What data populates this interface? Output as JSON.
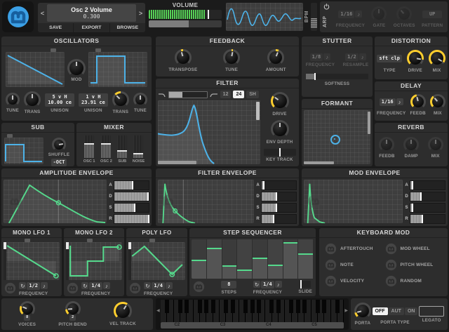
{
  "colors": {
    "blue": "#4db2e8",
    "green": "#55d98c",
    "yellow": "#ffce2e",
    "panel": "#2d2d2d",
    "background": "#1b1b1b"
  },
  "header": {
    "patch_name": "Osc 2 Volume",
    "patch_value": "0.300",
    "prev": "<",
    "next": ">",
    "save": "SAVE",
    "export": "EXPORT",
    "browse": "BROWSE",
    "volume_label": "VOLUME",
    "bpm_label": "BPM",
    "arp": {
      "title": "ARP",
      "frequency_label": "FREQUENCY",
      "frequency_value": "1/16",
      "gate_label": "GATE",
      "gate_knob": {
        "value": 0.5,
        "mode": "plain",
        "dim": true
      },
      "octaves_label": "OCTAVES",
      "octaves_knob": {
        "value": 0.35,
        "mode": "plain",
        "dim": true
      },
      "pattern_label": "PATTERN",
      "pattern_value": "UP"
    }
  },
  "oscillators": {
    "title": "OSCILLATORS",
    "mod_label": "MOD",
    "mod_knob": {
      "value": 0.5,
      "mode": "plain"
    },
    "tune1_label": "TUNE",
    "tune1_knob": {
      "value": 0.5,
      "mode": "plain"
    },
    "trans1_label": "TRANS",
    "trans1_knob": {
      "value": 0.5,
      "mode": "plain"
    },
    "unison1_top": "5 v H",
    "unison1_bottom": "10.00 ce",
    "unison1_label": "UNISON",
    "unison2_top": "1 v H",
    "unison2_bottom": "23.91 ce",
    "unison2_label": "UNISON",
    "trans2_label": "TRANS",
    "trans2_knob": {
      "value": 0.33,
      "mode": "bi"
    },
    "tune2_label": "TUNE",
    "tune2_knob": {
      "value": 0.5,
      "mode": "plain"
    }
  },
  "sub": {
    "title": "SUB",
    "shuffle_label": "SHUFFLE",
    "shuffle_knob": {
      "value": 0.8,
      "mode": "plain"
    },
    "oct_button": "-OCT"
  },
  "mixer": {
    "title": "MIXER",
    "channels": [
      {
        "label": "OSC 1",
        "value": 0.6
      },
      {
        "label": "OSC 2",
        "value": 0.6
      },
      {
        "label": "SUB",
        "value": 0.28
      },
      {
        "label": "NOISE",
        "value": 0.17
      }
    ]
  },
  "feedback": {
    "title": "FEEDBACK",
    "knobs": [
      {
        "label": "TRANSPOSE",
        "value": 0.44,
        "mode": "bi"
      },
      {
        "label": "TUNE",
        "value": 0.54,
        "mode": "bi"
      },
      {
        "label": "AMOUNT",
        "value": 0.58,
        "mode": "bi"
      }
    ]
  },
  "filter": {
    "title": "FILTER",
    "pole_12": "12",
    "pole_24": "24",
    "pole_sh": "SH",
    "drive_label": "DRIVE",
    "drive_knob": {
      "value": 0.3,
      "mode": "uni"
    },
    "env_depth_label": "ENV DEPTH",
    "env_depth_knob": {
      "value": 0.5,
      "mode": "plain"
    },
    "key_track_label": "KEY TRACK"
  },
  "stutter": {
    "title": "STUTTER",
    "frequency_label": "FREQUENCY",
    "frequency_value": "1/8",
    "resample_label": "RESAMPLE",
    "resample_value": "1/2",
    "softness_label": "SOFTNESS"
  },
  "formant": {
    "title": "FORMANT"
  },
  "distortion": {
    "title": "DISTORTION",
    "type_label": "TYPE",
    "type_value": "sft clp",
    "drive_label": "DRIVE",
    "drive_knob": {
      "value": 0.87,
      "mode": "uni"
    },
    "mix_label": "MIX",
    "mix_knob": {
      "value": 0.95,
      "mode": "uni"
    }
  },
  "delay": {
    "title": "DELAY",
    "frequency_label": "FREQUENCY",
    "frequency_value": "1/16",
    "feedb_label": "FEEDB",
    "feedb_knob": {
      "value": 0.45,
      "mode": "uni"
    },
    "mix_label": "MIX",
    "mix_knob": {
      "value": 0.35,
      "mode": "uni"
    }
  },
  "reverb": {
    "title": "REVERB",
    "knobs": [
      {
        "label": "FEEDB",
        "value": 0.5,
        "mode": "plain",
        "dim": true
      },
      {
        "label": "DAMP",
        "value": 0.5,
        "mode": "plain",
        "dim": true
      },
      {
        "label": "MIX",
        "value": 0.5,
        "mode": "plain",
        "dim": true
      }
    ]
  },
  "envelopes": [
    {
      "title": "AMPLITUDE ENVELOPE",
      "adsr": [
        {
          "label": "A",
          "value": 0.52
        },
        {
          "label": "D",
          "value": 0.95
        },
        {
          "label": "S",
          "value": 0.58
        },
        {
          "label": "R",
          "value": 0.97
        }
      ]
    },
    {
      "title": "FILTER ENVELOPE",
      "adsr": [
        {
          "label": "A",
          "value": 0.05
        },
        {
          "label": "D",
          "value": 0.4
        },
        {
          "label": "S",
          "value": 0.4
        },
        {
          "label": "R",
          "value": 0.33
        }
      ]
    },
    {
      "title": "MOD ENVELOPE",
      "adsr": [
        {
          "label": "A",
          "value": 0.05
        },
        {
          "label": "D",
          "value": 0.28
        },
        {
          "label": "S",
          "value": 0.05
        },
        {
          "label": "R",
          "value": 0.33
        }
      ]
    }
  ],
  "lfos": [
    {
      "title": "MONO LFO 1",
      "frequency_value": "1/2",
      "frequency_label": "FREQUENCY"
    },
    {
      "title": "MONO LFO 2",
      "frequency_value": "1/4",
      "frequency_label": "FREQUENCY"
    },
    {
      "title": "POLY LFO",
      "frequency_value": "1/4",
      "frequency_label": "FREQUENCY"
    }
  ],
  "step_sequencer": {
    "title": "STEP SEQUENCER",
    "steps_label": "STEPS",
    "steps_value": "8",
    "frequency_label": "FREQUENCY",
    "frequency_value": "1/4",
    "slide_label": "SLIDE",
    "values": [
      0.45,
      0.75,
      0.3,
      0.2,
      0.5,
      0.33,
      0.9,
      0.6
    ]
  },
  "keyboard_mod": {
    "title": "KEYBOARD MOD",
    "items": [
      "AFTERTOUCH",
      "MOD WHEEL",
      "NOTE",
      "PITCH WHEEL",
      "VELOCITY",
      "RANDOM"
    ]
  },
  "bottom": {
    "voices_label": "VOICES",
    "voices_value": "8",
    "voices_knob": {
      "value": 0.25,
      "mode": "uni"
    },
    "pitch_bend_label": "PITCH BEND",
    "pitch_bend_value": "2",
    "pitch_bend_knob": {
      "value": 0.15,
      "mode": "uni"
    },
    "vel_track_label": "VEL TRACK",
    "vel_track_knob": {
      "value": 0.62,
      "mode": "uni"
    },
    "porta_label": "PORTA",
    "porta_knob": {
      "value": 0.12,
      "mode": "uni"
    },
    "porta_type_label": "PORTA TYPE",
    "porta_options": [
      "OFF",
      "AUT",
      "ON"
    ],
    "porta_selected": "OFF",
    "legato_label": "LEGATO",
    "octave_labels": [
      "C2",
      "C3",
      "C4",
      "C5"
    ]
  }
}
